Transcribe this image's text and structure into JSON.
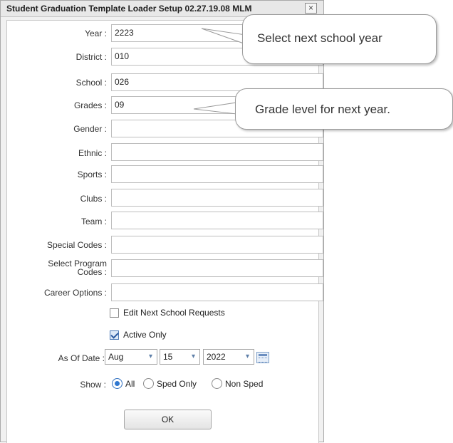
{
  "window": {
    "title": "Student Graduation Template Loader Setup 02.27.19.08 MLM",
    "close_glyph": "×"
  },
  "form": {
    "fields": [
      {
        "label": "Year :",
        "value": "2223"
      },
      {
        "label": "District :",
        "value": "010"
      },
      {
        "label": "School :",
        "value": "026"
      },
      {
        "label": "Grades :",
        "value": "09"
      },
      {
        "label": "Gender :",
        "value": ""
      },
      {
        "label": "Ethnic :",
        "value": ""
      },
      {
        "label": "Sports :",
        "value": ""
      },
      {
        "label": "Clubs :",
        "value": ""
      },
      {
        "label": "Team :",
        "value": ""
      },
      {
        "label": "Special Codes :",
        "value": ""
      },
      {
        "label": "Career Options :",
        "value": ""
      }
    ],
    "program_codes": {
      "label_line1": "Select Program",
      "label_line2": "Codes :",
      "value": ""
    },
    "edit_next_school_requests": {
      "label": "Edit Next School Requests",
      "checked": false
    },
    "active_only": {
      "label": "Active Only",
      "checked": true
    },
    "as_of_date": {
      "label": "As Of Date :",
      "month": "Aug",
      "day": "15",
      "year": "2022",
      "calendar_icon": "calendar-icon"
    },
    "show": {
      "label": "Show :",
      "options": [
        {
          "label": "All",
          "selected": true
        },
        {
          "label": "Sped Only",
          "selected": false
        },
        {
          "label": "Non Sped",
          "selected": false
        }
      ]
    },
    "ok_label": "OK"
  },
  "annotations": {
    "year_callout": "Select next school year",
    "grades_callout": "Grade level for next year."
  }
}
